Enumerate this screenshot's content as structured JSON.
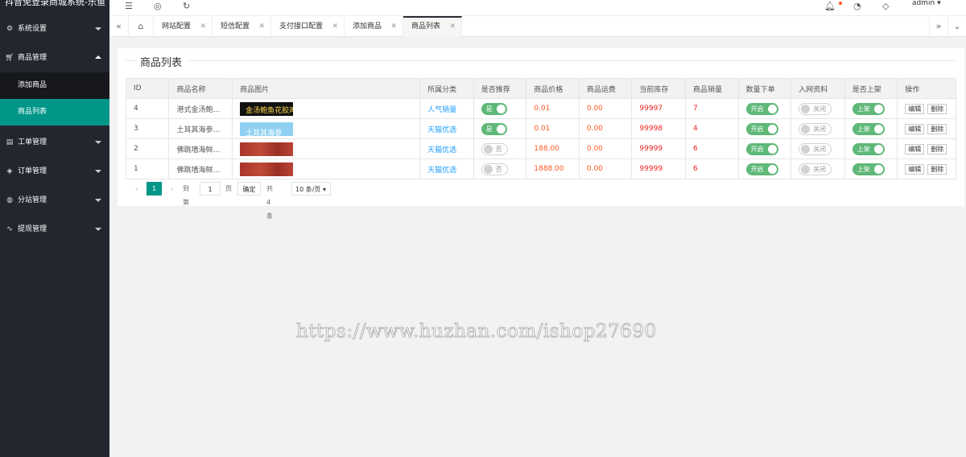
{
  "sidebar": {
    "logo": "抖音免登录商城系统-乐鱼",
    "items": [
      {
        "label": "系统设置",
        "icon": "gear-icon"
      },
      {
        "label": "商品管理",
        "icon": "cart-icon"
      },
      {
        "label": "工单管理",
        "icon": "ticket-icon"
      },
      {
        "label": "订单管理",
        "icon": "order-icon"
      },
      {
        "label": "分站管理",
        "icon": "globe-icon"
      },
      {
        "label": "提现管理",
        "icon": "chart-icon"
      }
    ],
    "sub_items": [
      {
        "label": "添加商品"
      },
      {
        "label": "商品列表"
      }
    ]
  },
  "header": {
    "user": "admin"
  },
  "tabs": [
    {
      "label": "网站配置"
    },
    {
      "label": "短信配置"
    },
    {
      "label": "支付接口配置"
    },
    {
      "label": "添加商品"
    },
    {
      "label": "商品列表"
    }
  ],
  "panel": {
    "title": "商品列表",
    "columns": [
      "ID",
      "商品名称",
      "商品图片",
      "所属分类",
      "是否推荐",
      "商品价格",
      "商品运费",
      "当前库存",
      "商品销量",
      "数量下单",
      "入网资料",
      "是否上架",
      "操作"
    ],
    "rows": [
      {
        "id": "4",
        "name": "港式金汤鲍…",
        "image_text": "金汤鲍鱼花胶鸡",
        "image": "black",
        "category": "人气销量",
        "recommend": "是",
        "price": "0.01",
        "freight": "0.00",
        "stock": "99997",
        "sales": "7",
        "qty_order": "开启",
        "net_info": "关闭",
        "on_shelf": "上架"
      },
      {
        "id": "3",
        "name": "土耳其海参…",
        "image_text": "土耳其海参",
        "image": "blue",
        "category": "天猫优选",
        "recommend": "是",
        "price": "0.01",
        "freight": "0.00",
        "stock": "99998",
        "sales": "4",
        "qty_order": "开启",
        "net_info": "关闭",
        "on_shelf": "上架"
      },
      {
        "id": "2",
        "name": "佛跳墙海鲜…",
        "image_text": "",
        "image": "red",
        "category": "天猫优选",
        "recommend": "否",
        "price": "188.00",
        "freight": "0.00",
        "stock": "99999",
        "sales": "6",
        "qty_order": "开启",
        "net_info": "关闭",
        "on_shelf": "上架"
      },
      {
        "id": "1",
        "name": "佛跳墙海鲜…",
        "image_text": "",
        "image": "red",
        "category": "天猫优选",
        "recommend": "否",
        "price": "1888.00",
        "freight": "0.00",
        "stock": "99999",
        "sales": "6",
        "qty_order": "开启",
        "net_info": "关闭",
        "on_shelf": "上架"
      }
    ],
    "actions": {
      "edit": "编辑",
      "delete": "删除"
    },
    "pager": {
      "current": "1",
      "goto_label": "到第",
      "goto_value": "1",
      "page_unit": "页",
      "confirm": "确定",
      "total": "共 4 条",
      "page_size": "10 条/页"
    }
  },
  "watermark": "https://www.huzhan.com/ishop27690",
  "colors": {
    "sidebar": "#23262e",
    "accent": "#009688",
    "switch_on": "#5fb878",
    "link": "#1e9fff",
    "price": "#ff5722"
  }
}
